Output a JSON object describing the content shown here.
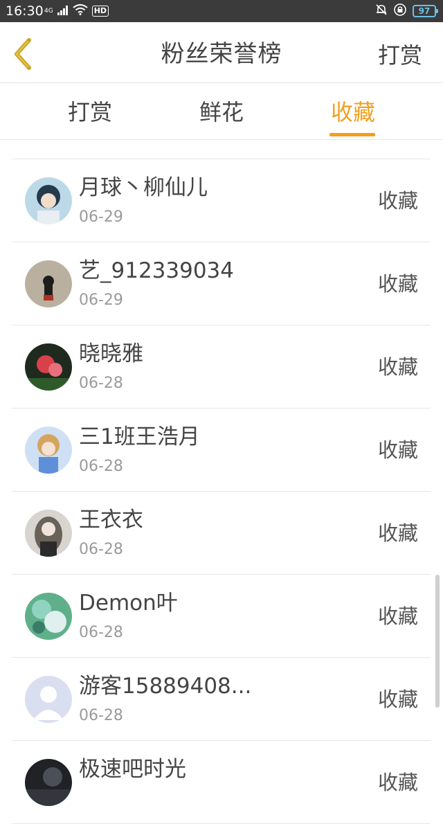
{
  "status_bar": {
    "time": "16:30",
    "network": "4G",
    "hd": "HD",
    "battery": "97",
    "icons": [
      "signal-icon",
      "wifi-icon",
      "mute-icon",
      "rotation-lock-icon",
      "battery-icon"
    ]
  },
  "header": {
    "title": "粉丝荣誉榜",
    "action": "打赏",
    "back_icon": "chevron-left-icon"
  },
  "tabs": [
    {
      "label": "打赏",
      "active": false
    },
    {
      "label": "鲜花",
      "active": false
    },
    {
      "label": "收藏",
      "active": true
    }
  ],
  "colors": {
    "accent": "#f0a01e",
    "status_bar": "#3b3b3b",
    "text": "#444444",
    "muted": "#9a9a9a"
  },
  "fans": [
    {
      "name": "月球丶柳仙儿",
      "date": "06-29",
      "action": "收藏"
    },
    {
      "name": "艺_912339034",
      "date": "06-29",
      "action": "收藏"
    },
    {
      "name": "晓晓雅",
      "date": "06-28",
      "action": "收藏"
    },
    {
      "name": "三1班王浩月",
      "date": "06-28",
      "action": "收藏"
    },
    {
      "name": "王衣衣",
      "date": "06-28",
      "action": "收藏"
    },
    {
      "name": "Demon叶",
      "date": "06-28",
      "action": "收藏"
    },
    {
      "name": "游客15889408...",
      "date": "06-28",
      "action": "收藏"
    },
    {
      "name": "极速吧时光",
      "date": "",
      "action": "收藏"
    }
  ]
}
